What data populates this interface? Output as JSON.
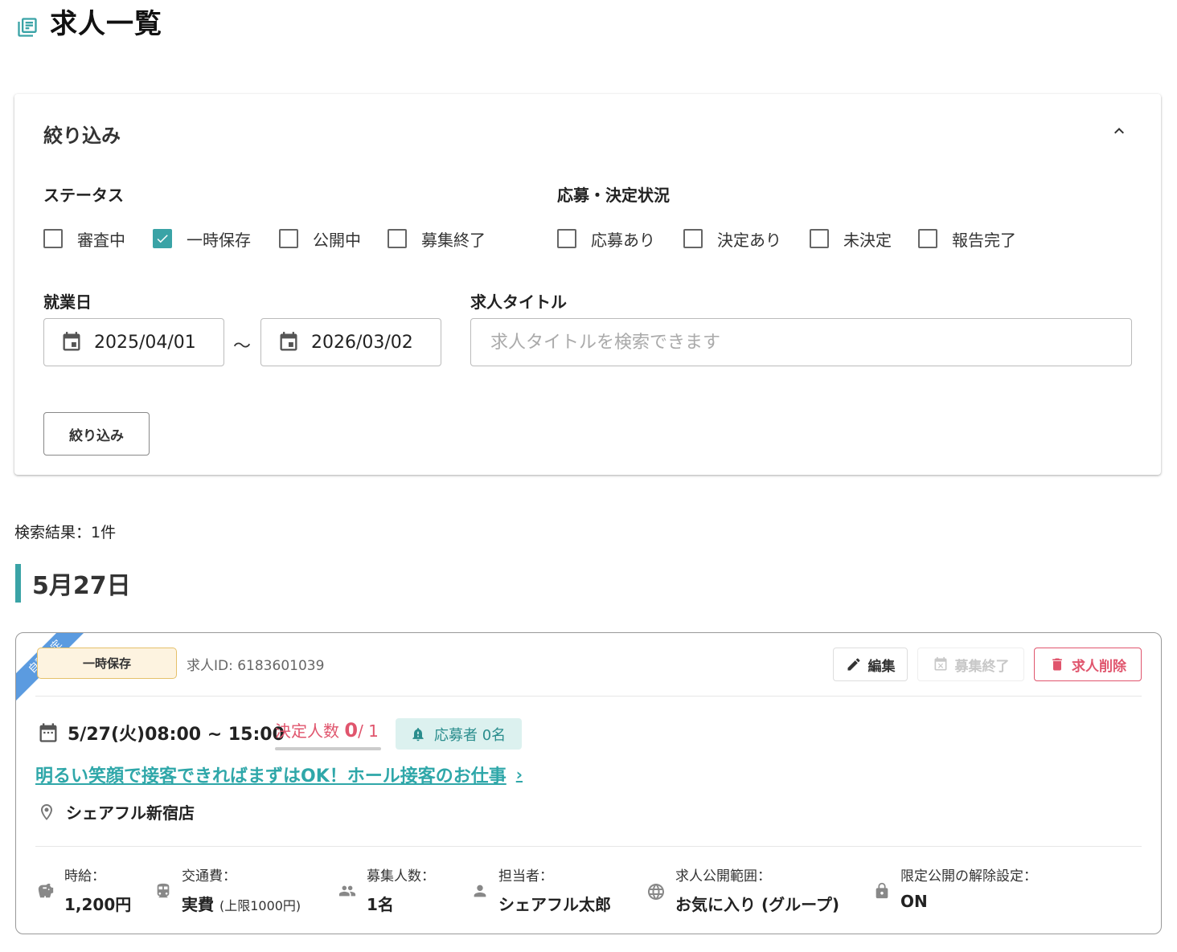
{
  "page": {
    "title": "求人一覧"
  },
  "filter": {
    "heading": "絞り込み",
    "status_label": "ステータス",
    "status_options": [
      {
        "label": "審査中",
        "checked": false
      },
      {
        "label": "一時保存",
        "checked": true
      },
      {
        "label": "公開中",
        "checked": false
      },
      {
        "label": "募集終了",
        "checked": false
      }
    ],
    "application_label": "応募・決定状況",
    "application_options": [
      {
        "label": "応募あり",
        "checked": false
      },
      {
        "label": "決定あり",
        "checked": false
      },
      {
        "label": "未決定",
        "checked": false
      },
      {
        "label": "報告完了",
        "checked": false
      }
    ],
    "workday_label": "就業日",
    "date_from": "2025/04/01",
    "date_separator": "～",
    "date_to": "2026/03/02",
    "job_title_label": "求人タイトル",
    "job_title_value": "",
    "job_title_placeholder": "求人タイトルを検索できます",
    "submit_label": "絞り込み"
  },
  "results": {
    "count_text": "検索結果：1件"
  },
  "group": {
    "date_heading": "5月27日"
  },
  "job": {
    "ribbon": "自動決定",
    "status": "一時保存",
    "job_id": "求人ID: 6183601039",
    "edit_label": "編集",
    "close_label": "募集終了",
    "delete_label": "求人削除",
    "schedule": "5/27(火)08:00 ~ 15:00",
    "decided_label": "決定人数",
    "decided_count": "0",
    "decided_total": "/ 1",
    "applicants": "応募者 0名",
    "title": "明るい笑顔で接客できればまずはOK！ホール接客のお仕事",
    "store": "シェアフル新宿店",
    "details": {
      "wage_label": "時給：",
      "wage_value": "1,200円",
      "transport_label": "交通費：",
      "transport_value": "実費",
      "transport_note": "(上限1000円)",
      "headcount_label": "募集人数：",
      "headcount_value": "1名",
      "manager_label": "担当者：",
      "manager_value": "シェアフル太郎",
      "scope_label": "求人公開範囲：",
      "scope_value": "お気に入り (グループ)",
      "unlock_label": "限定公開の解除設定：",
      "unlock_value": "ON"
    }
  },
  "colors": {
    "accent": "#3aa3a6",
    "danger": "#e0556d",
    "ribbon": "#5b9be0",
    "status_chip_bg": "#fdf3e0"
  }
}
